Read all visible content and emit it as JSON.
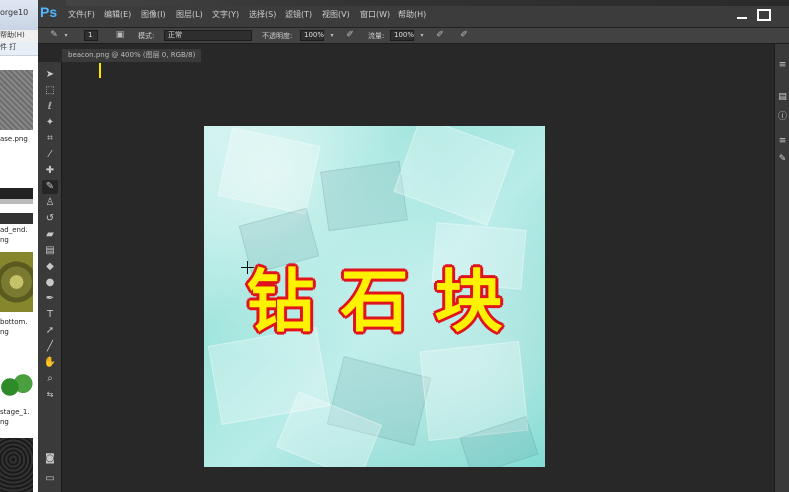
{
  "background_app": {
    "title": "orge10",
    "menu": "帮助(H)",
    "toolbar": "件   打",
    "files": [
      {
        "label": "ase.png"
      },
      {
        "label": "ad_end."
      },
      {
        "label": "ng"
      },
      {
        "label": "bottom."
      },
      {
        "label": "ng"
      },
      {
        "label": "stage_1."
      },
      {
        "label": "ng"
      }
    ]
  },
  "app": {
    "logo": "Ps",
    "menu": [
      "文件(F)",
      "编辑(E)",
      "图像(I)",
      "图层(L)",
      "文字(Y)",
      "选择(S)",
      "滤镜(T)",
      "视图(V)",
      "窗口(W)",
      "帮助(H)"
    ]
  },
  "options_bar": {
    "brush_size": "1",
    "mode_label": "模式:",
    "mode_value": "正常",
    "opacity_label": "不透明度:",
    "opacity_value": "100%",
    "flow_label": "流量:",
    "flow_value": "100%"
  },
  "document": {
    "tab_title": "beacon.png @ 400% (图层 0, RGB/8)",
    "canvas_text": "钻石块"
  },
  "colors": {
    "foreground": "#3a2f5a",
    "background": "#ffffff",
    "text_fill": "#fff200",
    "text_stroke": "#e0121c"
  }
}
